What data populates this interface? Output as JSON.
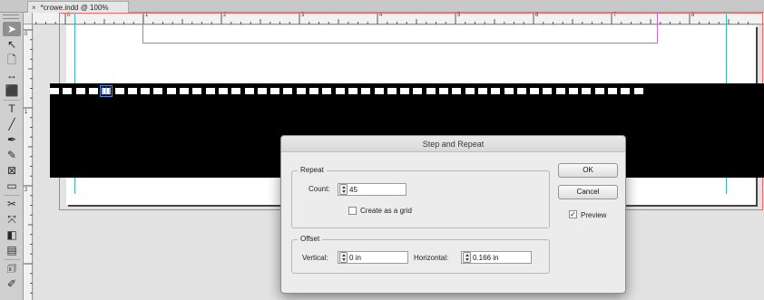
{
  "document": {
    "tab_title": "*crowe.indd @ 100%",
    "close_glyph": "×"
  },
  "ruler": {
    "h_labels": [
      "0",
      "1",
      "2",
      "3",
      "4",
      "5",
      "6",
      "7",
      "8"
    ],
    "v_labels": [
      "0",
      "1",
      "2"
    ]
  },
  "tools": [
    {
      "name": "selection-tool-icon",
      "glyph": "➤",
      "active": true
    },
    {
      "name": "direct-selection-tool-icon",
      "glyph": "↖",
      "active": false
    },
    {
      "name": "page-tool-icon",
      "glyph": "🗋",
      "active": false
    },
    {
      "name": "gap-tool-icon",
      "glyph": "↔",
      "active": false
    },
    {
      "name": "content-collector-icon",
      "glyph": "⬛",
      "active": false
    },
    {
      "name": "type-tool-icon",
      "glyph": "T",
      "active": false
    },
    {
      "name": "line-tool-icon",
      "glyph": "╱",
      "active": false
    },
    {
      "name": "pen-tool-icon",
      "glyph": "✒",
      "active": false
    },
    {
      "name": "pencil-tool-icon",
      "glyph": "✎",
      "active": false
    },
    {
      "name": "rectangle-frame-tool-icon",
      "glyph": "⊠",
      "active": false
    },
    {
      "name": "rectangle-tool-icon",
      "glyph": "▭",
      "active": false
    },
    {
      "name": "scissors-tool-icon",
      "glyph": "✂",
      "active": false
    },
    {
      "name": "free-transform-tool-icon",
      "glyph": "⤧",
      "active": false
    },
    {
      "name": "gradient-tool-icon",
      "glyph": "◧",
      "active": false
    },
    {
      "name": "gradient-feather-icon",
      "glyph": "▤",
      "active": false
    },
    {
      "name": "note-tool-icon",
      "glyph": "🗊",
      "active": false
    },
    {
      "name": "eyedropper-tool-icon",
      "glyph": "✐",
      "active": false
    }
  ],
  "dialog": {
    "title": "Step and Repeat",
    "repeat_legend": "Repeat",
    "count_label": "Count:",
    "count_value": "45",
    "grid_label": "Create as a grid",
    "grid_checked": false,
    "offset_legend": "Offset",
    "vertical_label": "Vertical:",
    "vertical_value": "0 in",
    "horizontal_label": "Horizontal:",
    "horizontal_value": "0.166 in",
    "ok_label": "OK",
    "cancel_label": "Cancel",
    "preview_label": "Preview",
    "preview_checked": true,
    "checkmark_glyph": "✓"
  },
  "colors": {
    "bleed": "#ee6a6a",
    "guide": "#38b7c4",
    "margin": "#c66ad0",
    "band": "#000000",
    "selection": "#4a8ddc"
  }
}
